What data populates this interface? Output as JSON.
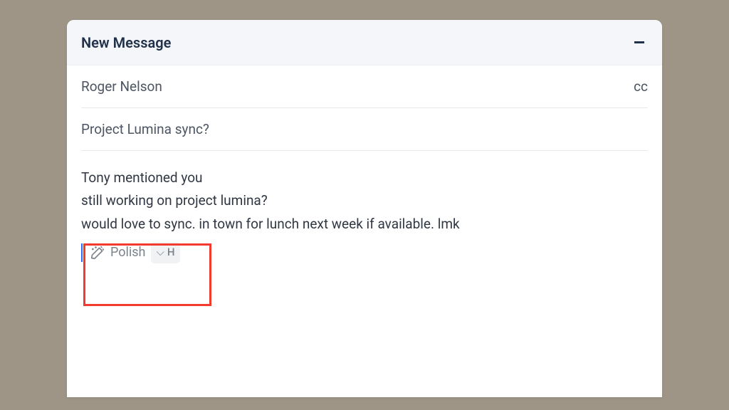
{
  "titlebar": {
    "title": "New Message"
  },
  "fields": {
    "recipient": "Roger Nelson",
    "cc_label": "cc",
    "subject": "Project Lumina sync?"
  },
  "body": {
    "line1": "Tony mentioned you",
    "line2": "still working on project lumina?",
    "line3": "would love to sync. in town for lunch next week if available. lmk"
  },
  "tooltip": {
    "label": "Polish",
    "shortcut_symbol": "⌵",
    "shortcut_key": "H"
  }
}
